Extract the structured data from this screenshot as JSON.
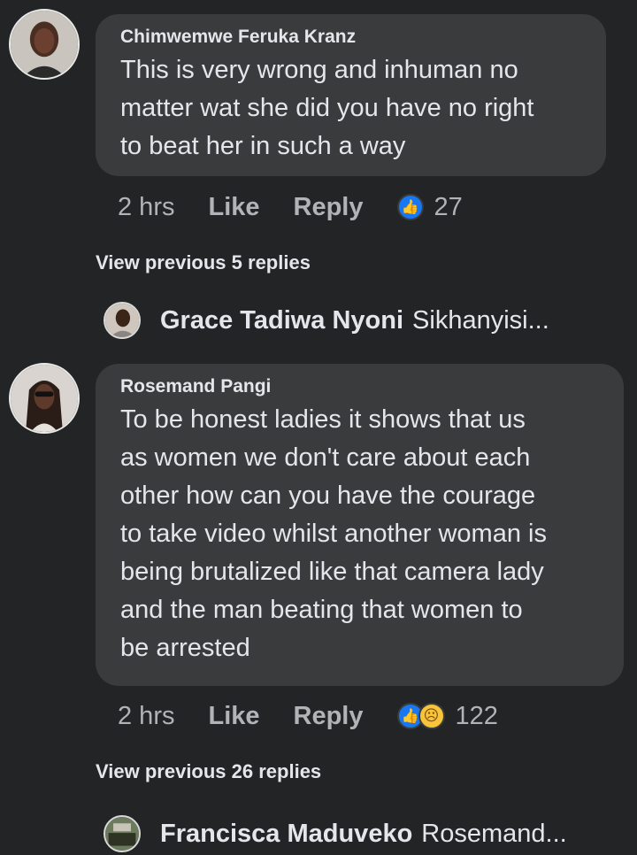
{
  "comments": [
    {
      "author": "Chimwemwe Feruka Kranz",
      "text": "This is very wrong and inhuman no\nmatter wat she did you have no right\nto beat her in such a way",
      "time": "2 hrs",
      "like_label": "Like",
      "reply_label": "Reply",
      "reactions": [
        "like-icon"
      ],
      "reaction_count": "27",
      "view_previous": "View previous 5 replies",
      "latest_reply": {
        "name": "Grace Tadiwa Nyoni",
        "snippet": "Sikhanyisi..."
      }
    },
    {
      "author": "Rosemand Pangi",
      "text": "To be honest ladies it shows that us\nas women we don't care about each\nother how can you have the courage\nto take video whilst another woman is\nbeing brutalized like that camera lady\nand the man beating that women to\nbe arrested",
      "time": "2 hrs",
      "like_label": "Like",
      "reply_label": "Reply",
      "reactions": [
        "like-icon",
        "sad-icon"
      ],
      "reaction_count": "122",
      "view_previous": "View previous 26 replies",
      "latest_reply": {
        "name": "Francisca Maduveko",
        "snippet": "Rosemand..."
      }
    }
  ],
  "colors": {
    "background": "#232425",
    "bubble": "#3a3b3c",
    "text": "#e4e6eb",
    "muted": "#b0b3b8",
    "like_blue": "#1877f2"
  }
}
